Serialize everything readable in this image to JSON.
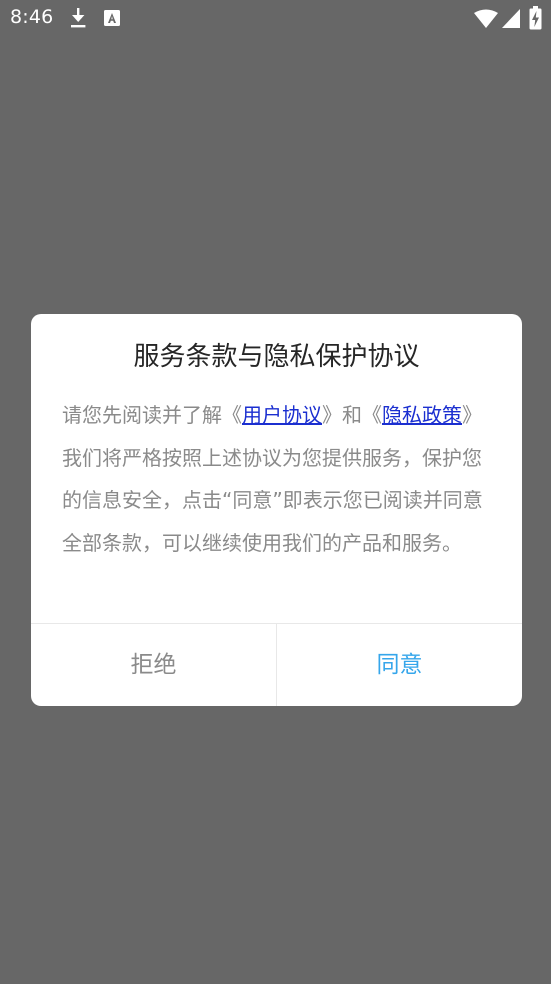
{
  "status_bar": {
    "time": "8:46",
    "icons": [
      "download-icon",
      "a-notification-icon",
      "wifi-icon",
      "cell-signal-icon",
      "battery-charging-icon"
    ]
  },
  "dialog": {
    "title": "服务条款与隐私保护协议",
    "body": {
      "intro": "请您先阅读并了解《",
      "user_agreement_link": "用户协议",
      "mid": "》和《",
      "privacy_policy_link": "隐私政策",
      "rest": "》我们将严格按照上述协议为您提供服务，保护您的信息安全，点击“同意”即表示您已阅读并同意全部条款，可以继续使用我们的产品和服务。"
    },
    "reject_label": "拒绝",
    "agree_label": "同意"
  },
  "colors": {
    "overlay_background": "#676767",
    "dialog_background": "#ffffff",
    "title_text": "#262626",
    "body_text": "#8a8a8a",
    "link": "#1b2fd0",
    "agree_accent": "#35a6eb",
    "divider": "#e8e8e8"
  }
}
